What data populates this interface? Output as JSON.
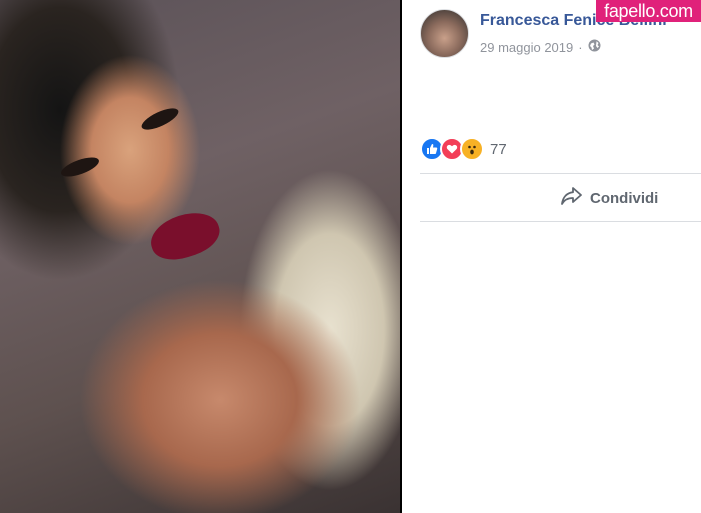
{
  "post": {
    "author": "Francesca Fenice Bellini",
    "date": "29 maggio 2019",
    "separator": "·",
    "privacy_icon": "globe-icon"
  },
  "reactions": {
    "icons": [
      "like-icon",
      "love-icon",
      "wow-icon"
    ],
    "count": "77"
  },
  "actions": {
    "share_label": "Condividi"
  },
  "watermark": "fapello.com",
  "colors": {
    "author_link": "#385898",
    "meta_text": "#90949c",
    "action_text": "#606770",
    "like": "#1877f2",
    "love": "#f33e58",
    "wow": "#f7b125",
    "watermark_bg": "#e0217a"
  }
}
